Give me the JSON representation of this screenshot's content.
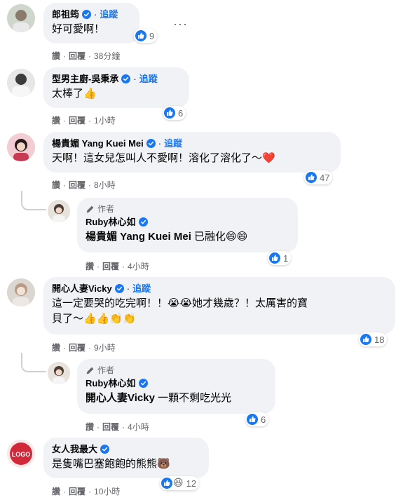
{
  "follow_label": "追蹤",
  "author_label": "作者",
  "actions": {
    "like": "讚",
    "reply": "回覆"
  },
  "comments": [
    {
      "name": "郎祖筠",
      "text": "好可愛啊！",
      "reactions": "9",
      "time": "38分鐘"
    },
    {
      "name": "型男主廚-吳秉承",
      "text": "太棒了👍",
      "reactions": "6",
      "time": "1小時"
    },
    {
      "name": "楊貴媚 Yang Kuei Mei",
      "text": "天啊！這女兒怎叫人不愛啊！溶化了溶化了～❤️",
      "reactions": "47",
      "time": "8小時"
    },
    {
      "name": "Ruby林心如",
      "mention": "楊貴媚 Yang Kuei Mei",
      "text": " 已融化😄😄",
      "reactions": "1",
      "time": "4小時"
    },
    {
      "name": "開心人妻Vicky",
      "text": "這一定要哭的吃完啊！！😭😭她才幾歲？！太厲害的寶",
      "text2": "貝了～👍👍👏👏",
      "reactions": "18",
      "time": "9小時"
    },
    {
      "name": "Ruby林心如",
      "mention": "開心人妻Vicky",
      "text": " 一顆不剩吃光光",
      "reactions": "6",
      "time": "4小時"
    },
    {
      "name": "女人我最大",
      "text": "是隻嘴巴塞飽飽的熊熊🐻",
      "reactions": "12",
      "time": "10小時"
    }
  ],
  "colors": {
    "accent": "#1877f2",
    "bubble": "#f0f2f5",
    "meta": "#65676b"
  }
}
